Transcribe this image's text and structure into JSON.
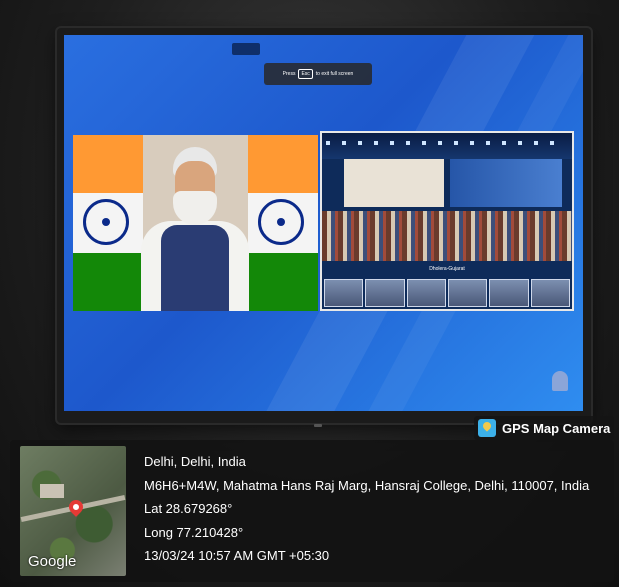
{
  "screen": {
    "top_tag": "",
    "esc_banner": {
      "prefix": "Press",
      "key": "Esc",
      "suffix": "to exit full screen"
    },
    "right_video_caption": "Dholera-Gujarat"
  },
  "gps_badge": {
    "icon": "gps-map-camera-icon",
    "label": "GPS Map Camera"
  },
  "location_info": {
    "map_logo": "Google",
    "city": "Delhi, Delhi, India",
    "address": "M6H6+M4W, Mahatma Hans Raj Marg, Hansraj College, Delhi, 110007, India",
    "lat": "Lat 28.679268°",
    "long": "Long 77.210428°",
    "timestamp": "13/03/24 10:57 AM GMT +05:30"
  },
  "colors": {
    "screen_blue": "#2a6fe0",
    "panel_bg": "#121212",
    "pin_red": "#e53935"
  }
}
